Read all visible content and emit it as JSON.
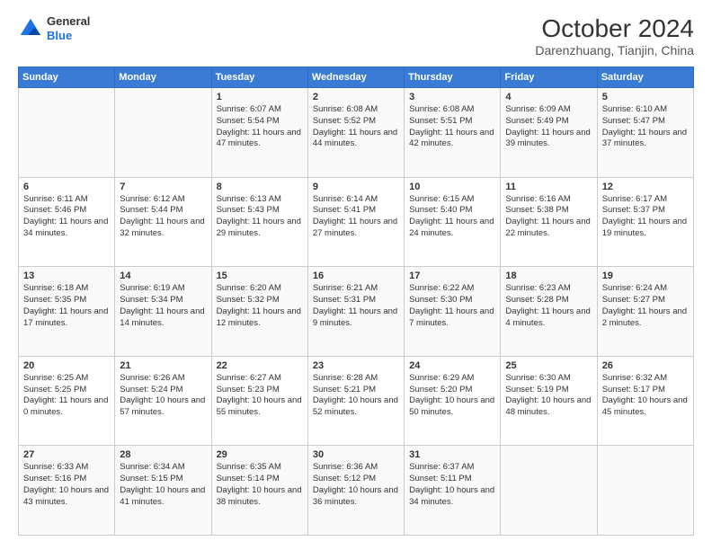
{
  "header": {
    "logo_general": "General",
    "logo_blue": "Blue",
    "month": "October 2024",
    "location": "Darenzhuang, Tianjin, China"
  },
  "weekdays": [
    "Sunday",
    "Monday",
    "Tuesday",
    "Wednesday",
    "Thursday",
    "Friday",
    "Saturday"
  ],
  "weeks": [
    [
      {
        "day": "",
        "sunrise": "",
        "sunset": "",
        "daylight": ""
      },
      {
        "day": "",
        "sunrise": "",
        "sunset": "",
        "daylight": ""
      },
      {
        "day": "1",
        "sunrise": "Sunrise: 6:07 AM",
        "sunset": "Sunset: 5:54 PM",
        "daylight": "Daylight: 11 hours and 47 minutes."
      },
      {
        "day": "2",
        "sunrise": "Sunrise: 6:08 AM",
        "sunset": "Sunset: 5:52 PM",
        "daylight": "Daylight: 11 hours and 44 minutes."
      },
      {
        "day": "3",
        "sunrise": "Sunrise: 6:08 AM",
        "sunset": "Sunset: 5:51 PM",
        "daylight": "Daylight: 11 hours and 42 minutes."
      },
      {
        "day": "4",
        "sunrise": "Sunrise: 6:09 AM",
        "sunset": "Sunset: 5:49 PM",
        "daylight": "Daylight: 11 hours and 39 minutes."
      },
      {
        "day": "5",
        "sunrise": "Sunrise: 6:10 AM",
        "sunset": "Sunset: 5:47 PM",
        "daylight": "Daylight: 11 hours and 37 minutes."
      }
    ],
    [
      {
        "day": "6",
        "sunrise": "Sunrise: 6:11 AM",
        "sunset": "Sunset: 5:46 PM",
        "daylight": "Daylight: 11 hours and 34 minutes."
      },
      {
        "day": "7",
        "sunrise": "Sunrise: 6:12 AM",
        "sunset": "Sunset: 5:44 PM",
        "daylight": "Daylight: 11 hours and 32 minutes."
      },
      {
        "day": "8",
        "sunrise": "Sunrise: 6:13 AM",
        "sunset": "Sunset: 5:43 PM",
        "daylight": "Daylight: 11 hours and 29 minutes."
      },
      {
        "day": "9",
        "sunrise": "Sunrise: 6:14 AM",
        "sunset": "Sunset: 5:41 PM",
        "daylight": "Daylight: 11 hours and 27 minutes."
      },
      {
        "day": "10",
        "sunrise": "Sunrise: 6:15 AM",
        "sunset": "Sunset: 5:40 PM",
        "daylight": "Daylight: 11 hours and 24 minutes."
      },
      {
        "day": "11",
        "sunrise": "Sunrise: 6:16 AM",
        "sunset": "Sunset: 5:38 PM",
        "daylight": "Daylight: 11 hours and 22 minutes."
      },
      {
        "day": "12",
        "sunrise": "Sunrise: 6:17 AM",
        "sunset": "Sunset: 5:37 PM",
        "daylight": "Daylight: 11 hours and 19 minutes."
      }
    ],
    [
      {
        "day": "13",
        "sunrise": "Sunrise: 6:18 AM",
        "sunset": "Sunset: 5:35 PM",
        "daylight": "Daylight: 11 hours and 17 minutes."
      },
      {
        "day": "14",
        "sunrise": "Sunrise: 6:19 AM",
        "sunset": "Sunset: 5:34 PM",
        "daylight": "Daylight: 11 hours and 14 minutes."
      },
      {
        "day": "15",
        "sunrise": "Sunrise: 6:20 AM",
        "sunset": "Sunset: 5:32 PM",
        "daylight": "Daylight: 11 hours and 12 minutes."
      },
      {
        "day": "16",
        "sunrise": "Sunrise: 6:21 AM",
        "sunset": "Sunset: 5:31 PM",
        "daylight": "Daylight: 11 hours and 9 minutes."
      },
      {
        "day": "17",
        "sunrise": "Sunrise: 6:22 AM",
        "sunset": "Sunset: 5:30 PM",
        "daylight": "Daylight: 11 hours and 7 minutes."
      },
      {
        "day": "18",
        "sunrise": "Sunrise: 6:23 AM",
        "sunset": "Sunset: 5:28 PM",
        "daylight": "Daylight: 11 hours and 4 minutes."
      },
      {
        "day": "19",
        "sunrise": "Sunrise: 6:24 AM",
        "sunset": "Sunset: 5:27 PM",
        "daylight": "Daylight: 11 hours and 2 minutes."
      }
    ],
    [
      {
        "day": "20",
        "sunrise": "Sunrise: 6:25 AM",
        "sunset": "Sunset: 5:25 PM",
        "daylight": "Daylight: 11 hours and 0 minutes."
      },
      {
        "day": "21",
        "sunrise": "Sunrise: 6:26 AM",
        "sunset": "Sunset: 5:24 PM",
        "daylight": "Daylight: 10 hours and 57 minutes."
      },
      {
        "day": "22",
        "sunrise": "Sunrise: 6:27 AM",
        "sunset": "Sunset: 5:23 PM",
        "daylight": "Daylight: 10 hours and 55 minutes."
      },
      {
        "day": "23",
        "sunrise": "Sunrise: 6:28 AM",
        "sunset": "Sunset: 5:21 PM",
        "daylight": "Daylight: 10 hours and 52 minutes."
      },
      {
        "day": "24",
        "sunrise": "Sunrise: 6:29 AM",
        "sunset": "Sunset: 5:20 PM",
        "daylight": "Daylight: 10 hours and 50 minutes."
      },
      {
        "day": "25",
        "sunrise": "Sunrise: 6:30 AM",
        "sunset": "Sunset: 5:19 PM",
        "daylight": "Daylight: 10 hours and 48 minutes."
      },
      {
        "day": "26",
        "sunrise": "Sunrise: 6:32 AM",
        "sunset": "Sunset: 5:17 PM",
        "daylight": "Daylight: 10 hours and 45 minutes."
      }
    ],
    [
      {
        "day": "27",
        "sunrise": "Sunrise: 6:33 AM",
        "sunset": "Sunset: 5:16 PM",
        "daylight": "Daylight: 10 hours and 43 minutes."
      },
      {
        "day": "28",
        "sunrise": "Sunrise: 6:34 AM",
        "sunset": "Sunset: 5:15 PM",
        "daylight": "Daylight: 10 hours and 41 minutes."
      },
      {
        "day": "29",
        "sunrise": "Sunrise: 6:35 AM",
        "sunset": "Sunset: 5:14 PM",
        "daylight": "Daylight: 10 hours and 38 minutes."
      },
      {
        "day": "30",
        "sunrise": "Sunrise: 6:36 AM",
        "sunset": "Sunset: 5:12 PM",
        "daylight": "Daylight: 10 hours and 36 minutes."
      },
      {
        "day": "31",
        "sunrise": "Sunrise: 6:37 AM",
        "sunset": "Sunset: 5:11 PM",
        "daylight": "Daylight: 10 hours and 34 minutes."
      },
      {
        "day": "",
        "sunrise": "",
        "sunset": "",
        "daylight": ""
      },
      {
        "day": "",
        "sunrise": "",
        "sunset": "",
        "daylight": ""
      }
    ]
  ]
}
